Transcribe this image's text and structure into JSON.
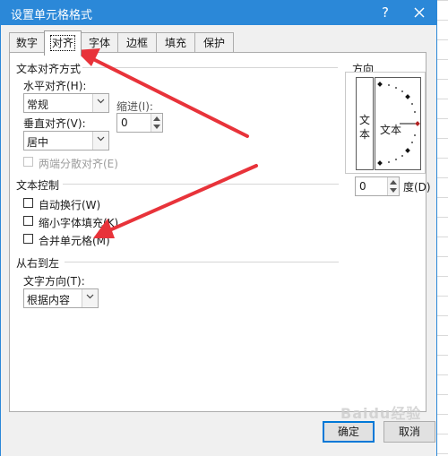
{
  "window": {
    "title": "设置单元格格式",
    "help_label": "?",
    "close_label": "×"
  },
  "tabs": [
    {
      "label": "数字",
      "active": false
    },
    {
      "label": "对齐",
      "active": true
    },
    {
      "label": "字体",
      "active": false
    },
    {
      "label": "边框",
      "active": false
    },
    {
      "label": "填充",
      "active": false
    },
    {
      "label": "保护",
      "active": false
    }
  ],
  "text_alignment": {
    "section_title": "文本对齐方式",
    "horizontal_label": "水平对齐(H):",
    "horizontal_value": "常规",
    "vertical_label": "垂直对齐(V):",
    "vertical_value": "居中",
    "indent_label": "缩进(I):",
    "indent_value": "0",
    "justify_distributed_label": "两端分散对齐(E)"
  },
  "text_control": {
    "section_title": "文本控制",
    "wrap_text_label": "自动换行(W)",
    "shrink_to_fit_label": "缩小字体填充(K)",
    "merge_cells_label": "合并单元格(M)"
  },
  "rtl": {
    "section_title": "从右到左",
    "direction_label": "文字方向(T):",
    "direction_value": "根据内容"
  },
  "orientation": {
    "section_title": "方向",
    "vertical_text": [
      "文",
      "本"
    ],
    "dial_text": "文本",
    "degrees_value": "0",
    "degrees_label": "度(D)"
  },
  "buttons": {
    "ok_label": "确定",
    "cancel_label": "取消"
  },
  "watermark": "Baidu经验",
  "colors": {
    "titlebar": "#2b88d8",
    "annotation_arrow": "#e8333a",
    "dial_marker": "#b22222"
  }
}
